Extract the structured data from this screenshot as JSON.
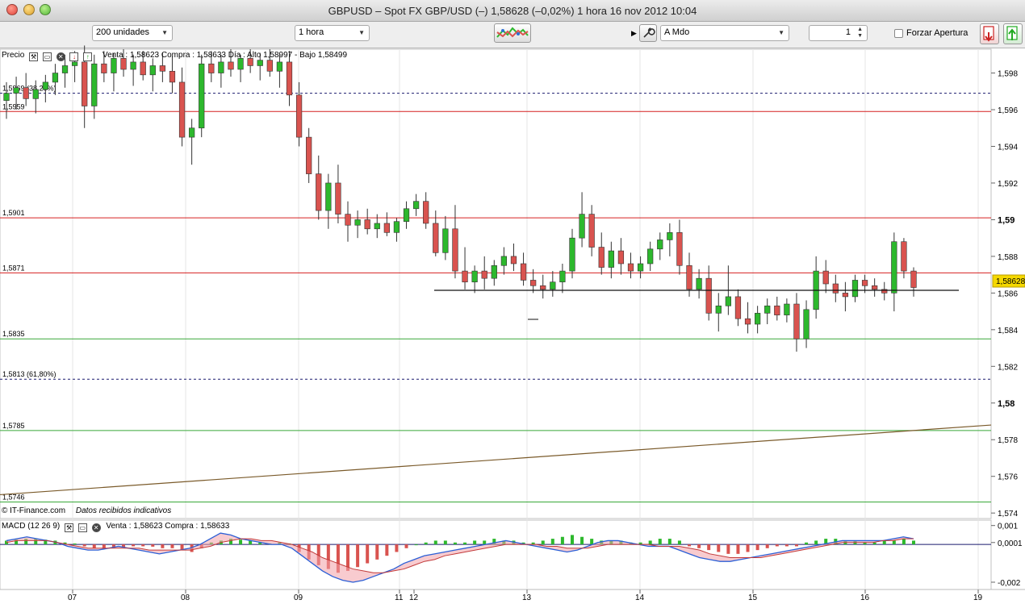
{
  "window": {
    "title": "GBPUSD – Spot FX GBP/USD (–)    1,58628 (–0,02%)    1 hora  16 nov 2012 10:04"
  },
  "toolbar": {
    "units": "200 unidades",
    "period": "1 hora",
    "order_type": "A Mdo",
    "quantity": "1",
    "force_open_label": "Forzar Apertura",
    "icons": [
      "indicators-icon",
      "settings-icon",
      "sell-icon",
      "buy-icon"
    ]
  },
  "price_panel": {
    "title": "Precio",
    "info": "Venta : 1,58623 Compra : 1,58633  Día : Alto 1,58997 - Bajo 1,58499",
    "credit": "© IT-Finance.com",
    "credit_note": "Datos recibidos indicativos",
    "current_price": "1,58628",
    "level_labels": [
      {
        "text": "1,5969 (38,20%)",
        "value": 1.5969
      },
      {
        "text": "1,5959",
        "value": 1.5959
      },
      {
        "text": "1,5901",
        "value": 1.5901
      },
      {
        "text": "1,5871",
        "value": 1.5871
      },
      {
        "text": "1,5835",
        "value": 1.5835
      },
      {
        "text": "1,5813 (61,80%)",
        "value": 1.5813
      },
      {
        "text": "1,5785",
        "value": 1.5785
      },
      {
        "text": "1,5746",
        "value": 1.5746
      }
    ]
  },
  "macd_panel": {
    "title": "MACD (12 26 9)",
    "info": "Venta : 1,58623 Compra : 1,58633",
    "y_labels": [
      "0,001",
      "0,0001",
      "-0,002"
    ]
  },
  "colors": {
    "up": "#2db82d",
    "down": "#d9534f",
    "resistance": "#d62020",
    "support": "#38a838",
    "fib": "#1a1a6e",
    "trend": "#7a5a2a",
    "price_tag": "#f5d800"
  },
  "chart_data": {
    "type": "candlestick",
    "title": "",
    "x_ticks": [
      "07",
      "08",
      "09",
      "11",
      "12",
      "13",
      "14",
      "15",
      "16",
      "19"
    ],
    "y_ticks": [
      "1,598",
      "1,596",
      "1,594",
      "1,592",
      "1,59",
      "1,588",
      "1,586",
      "1,584",
      "1,582",
      "1,58",
      "1,578",
      "1,576",
      "1,574"
    ],
    "ylim": [
      1.5737,
      1.5993
    ],
    "candles": [
      [
        1.5965,
        1.5975,
        1.5955,
        1.5969
      ],
      [
        1.5969,
        1.5978,
        1.596,
        1.5972
      ],
      [
        1.5972,
        1.598,
        1.5962,
        1.5966
      ],
      [
        1.5966,
        1.5976,
        1.5958,
        1.5971
      ],
      [
        1.5971,
        1.5979,
        1.5964,
        1.5975
      ],
      [
        1.5975,
        1.5985,
        1.5968,
        1.598
      ],
      [
        1.598,
        1.599,
        1.5972,
        1.5984
      ],
      [
        1.5984,
        1.5992,
        1.5975,
        1.5986
      ],
      [
        1.5986,
        1.5995,
        1.595,
        1.5962
      ],
      [
        1.5962,
        1.599,
        1.5955,
        1.5985
      ],
      [
        1.5985,
        1.5992,
        1.5975,
        1.598
      ],
      [
        1.598,
        1.5991,
        1.597,
        1.5988
      ],
      [
        1.5988,
        1.5993,
        1.5978,
        1.5982
      ],
      [
        1.5982,
        1.599,
        1.5973,
        1.5986
      ],
      [
        1.5986,
        1.5992,
        1.5976,
        1.5979
      ],
      [
        1.5979,
        1.5988,
        1.597,
        1.5984
      ],
      [
        1.5984,
        1.5991,
        1.5975,
        1.5981
      ],
      [
        1.5981,
        1.5989,
        1.5969,
        1.5975
      ],
      [
        1.5975,
        1.5983,
        1.594,
        1.5945
      ],
      [
        1.5945,
        1.5955,
        1.593,
        1.595
      ],
      [
        1.595,
        1.599,
        1.5945,
        1.5985
      ],
      [
        1.5985,
        1.5992,
        1.5975,
        1.598
      ],
      [
        1.598,
        1.599,
        1.5972,
        1.5986
      ],
      [
        1.5986,
        1.5993,
        1.5978,
        1.5982
      ],
      [
        1.5982,
        1.599,
        1.5975,
        1.5988
      ],
      [
        1.5988,
        1.5993,
        1.598,
        1.5984
      ],
      [
        1.5984,
        1.5991,
        1.5976,
        1.5987
      ],
      [
        1.5987,
        1.5993,
        1.5978,
        1.5981
      ],
      [
        1.5981,
        1.599,
        1.5972,
        1.5986
      ],
      [
        1.5986,
        1.5992,
        1.5962,
        1.5968
      ],
      [
        1.5968,
        1.5975,
        1.594,
        1.5945
      ],
      [
        1.5945,
        1.595,
        1.592,
        1.5925
      ],
      [
        1.5925,
        1.5935,
        1.59,
        1.5905
      ],
      [
        1.5905,
        1.5925,
        1.5895,
        1.592
      ],
      [
        1.592,
        1.593,
        1.5898,
        1.5903
      ],
      [
        1.5903,
        1.591,
        1.5888,
        1.5897
      ],
      [
        1.5897,
        1.5905,
        1.589,
        1.59
      ],
      [
        1.59,
        1.5906,
        1.5892,
        1.5895
      ],
      [
        1.5895,
        1.5903,
        1.589,
        1.5898
      ],
      [
        1.5898,
        1.5904,
        1.5891,
        1.5893
      ],
      [
        1.5893,
        1.5901,
        1.5888,
        1.5899
      ],
      [
        1.5899,
        1.591,
        1.5895,
        1.5906
      ],
      [
        1.5906,
        1.5914,
        1.5902,
        1.591
      ],
      [
        1.591,
        1.5915,
        1.5895,
        1.5898
      ],
      [
        1.5898,
        1.5905,
        1.588,
        1.5882
      ],
      [
        1.5882,
        1.5902,
        1.5878,
        1.5895
      ],
      [
        1.5895,
        1.5908,
        1.5868,
        1.5872
      ],
      [
        1.5872,
        1.5885,
        1.5862,
        1.5866
      ],
      [
        1.5866,
        1.5875,
        1.586,
        1.5872
      ],
      [
        1.5872,
        1.588,
        1.5862,
        1.5868
      ],
      [
        1.5868,
        1.5878,
        1.5864,
        1.5875
      ],
      [
        1.5875,
        1.5885,
        1.587,
        1.588
      ],
      [
        1.588,
        1.5887,
        1.5872,
        1.5876
      ],
      [
        1.5876,
        1.5882,
        1.5864,
        1.5867
      ],
      [
        1.5867,
        1.5873,
        1.586,
        1.5864
      ],
      [
        1.5864,
        1.587,
        1.5857,
        1.5862
      ],
      [
        1.5862,
        1.5872,
        1.5858,
        1.5866
      ],
      [
        1.5866,
        1.5876,
        1.586,
        1.5872
      ],
      [
        1.5872,
        1.5895,
        1.5868,
        1.589
      ],
      [
        1.589,
        1.5915,
        1.5885,
        1.5903
      ],
      [
        1.5903,
        1.5908,
        1.588,
        1.5885
      ],
      [
        1.5885,
        1.5893,
        1.587,
        1.5874
      ],
      [
        1.5874,
        1.5888,
        1.5868,
        1.5883
      ],
      [
        1.5883,
        1.589,
        1.587,
        1.5876
      ],
      [
        1.5876,
        1.5882,
        1.5868,
        1.5872
      ],
      [
        1.5872,
        1.588,
        1.5868,
        1.5876
      ],
      [
        1.5876,
        1.5888,
        1.5872,
        1.5884
      ],
      [
        1.5884,
        1.5893,
        1.5878,
        1.5889
      ],
      [
        1.5889,
        1.5898,
        1.588,
        1.5893
      ],
      [
        1.5893,
        1.59,
        1.587,
        1.5875
      ],
      [
        1.5875,
        1.5882,
        1.5858,
        1.5862
      ],
      [
        1.5862,
        1.5873,
        1.5857,
        1.5868
      ],
      [
        1.5868,
        1.5875,
        1.5845,
        1.5849
      ],
      [
        1.5849,
        1.586,
        1.5839,
        1.5853
      ],
      [
        1.5853,
        1.5875,
        1.5848,
        1.5858
      ],
      [
        1.5858,
        1.5862,
        1.5842,
        1.5846
      ],
      [
        1.5846,
        1.5855,
        1.5838,
        1.5843
      ],
      [
        1.5843,
        1.5853,
        1.5838,
        1.5849
      ],
      [
        1.5849,
        1.5857,
        1.5843,
        1.5853
      ],
      [
        1.5853,
        1.5858,
        1.5845,
        1.5848
      ],
      [
        1.5848,
        1.5857,
        1.5844,
        1.5854
      ],
      [
        1.5854,
        1.586,
        1.5828,
        1.5835
      ],
      [
        1.5835,
        1.5856,
        1.583,
        1.5851
      ],
      [
        1.5851,
        1.588,
        1.5846,
        1.5872
      ],
      [
        1.5872,
        1.5878,
        1.586,
        1.5865
      ],
      [
        1.5865,
        1.587,
        1.5855,
        1.586
      ],
      [
        1.586,
        1.5866,
        1.585,
        1.5858
      ],
      [
        1.5858,
        1.587,
        1.5855,
        1.5867
      ],
      [
        1.5867,
        1.587,
        1.586,
        1.5864
      ],
      [
        1.5864,
        1.5868,
        1.5858,
        1.5862
      ],
      [
        1.5862,
        1.5866,
        1.5856,
        1.586
      ],
      [
        1.586,
        1.5893,
        1.585,
        1.5888
      ],
      [
        1.5888,
        1.589,
        1.5868,
        1.5872
      ],
      [
        1.5872,
        1.5874,
        1.5858,
        1.5863
      ]
    ],
    "horizontal_levels": [
      {
        "value": 1.5969,
        "style": "fib-dashed"
      },
      {
        "value": 1.5959,
        "style": "resistance"
      },
      {
        "value": 1.5901,
        "style": "resistance"
      },
      {
        "value": 1.5871,
        "style": "resistance"
      },
      {
        "value": 1.5835,
        "style": "support"
      },
      {
        "value": 1.5813,
        "style": "fib-dashed"
      },
      {
        "value": 1.5785,
        "style": "support"
      },
      {
        "value": 1.5746,
        "style": "support"
      }
    ],
    "trendline": {
      "from_value": 1.575,
      "to_value": 1.5788
    },
    "macd": {
      "ylim": [
        -0.0023,
        0.0012
      ],
      "histogram": [
        0.0002,
        0.00025,
        0.0003,
        0.0003,
        0.00025,
        0.0002,
        0.0001,
        5e-05,
        -0.0001,
        -0.0002,
        -0.00025,
        -0.0002,
        -0.00015,
        -0.0001,
        -0.0001,
        -0.00012,
        -0.0002,
        -0.0002,
        -0.0003,
        -0.0004,
        -0.0002,
        0.0001,
        0.0002,
        0.0003,
        0.00025,
        0.0002,
        0.0001,
        5e-05,
        0.0001,
        5e-05,
        -0.0004,
        -0.0008,
        -0.0011,
        -0.0013,
        -0.0015,
        -0.0014,
        -0.0012,
        -0.001,
        -0.0008,
        -0.0006,
        -0.0004,
        -0.0002,
        0.0,
        0.0001,
        0.0002,
        0.0002,
        0.0001,
        0.0001,
        0.0002,
        0.0002,
        0.0003,
        0.0002,
        0.0002,
        0.0001,
        0.0001,
        0.0002,
        0.0003,
        0.0004,
        0.0005,
        0.0004,
        0.0003,
        0.0002,
        0.0002,
        0.0002,
        0.0001,
        0.0001,
        0.0002,
        0.0003,
        0.0003,
        0.0002,
        -0.0001,
        -0.0002,
        -0.0003,
        -0.0004,
        -0.0005,
        -0.0005,
        -0.0004,
        -0.0003,
        -0.0002,
        -0.0001,
        -0.0001,
        -0.0001,
        0.0001,
        0.0002,
        0.0003,
        0.0003,
        0.0002,
        0.0002,
        0.0001,
        0.0001,
        0.0002,
        0.0002,
        0.0003,
        0.0002
      ],
      "macd_line": [
        0.0002,
        0.0003,
        0.0004,
        0.0003,
        0.0002,
        0.0001,
        -0.0001,
        -0.0002,
        -0.0003,
        -0.0003,
        -0.0002,
        -0.0001,
        -0.0002,
        -0.0003,
        -0.0004,
        -0.0005,
        -0.0004,
        -0.0003,
        -0.0002,
        0.0,
        0.0003,
        0.0006,
        0.0005,
        0.0003,
        0.0002,
        0.0001,
        0.0,
        0.0,
        -0.0002,
        -0.0006,
        -0.001,
        -0.0014,
        -0.0017,
        -0.0019,
        -0.002,
        -0.0019,
        -0.0017,
        -0.0015,
        -0.0013,
        -0.001,
        -0.0008,
        -0.0006,
        -0.0005,
        -0.0004,
        -0.0003,
        -0.0002,
        -0.0001,
        0.0,
        0.0001,
        0.0002,
        0.0001,
        0.0,
        -0.0001,
        -0.0002,
        -0.0003,
        -0.0004,
        -0.0003,
        -0.0001,
        0.0001,
        0.0002,
        0.0002,
        0.0001,
        0.0,
        -0.0001,
        -0.0001,
        -0.0001,
        -0.0003,
        -0.0005,
        -0.0007,
        -0.0008,
        -0.0009,
        -0.0009,
        -0.0008,
        -0.0007,
        -0.0006,
        -0.0005,
        -0.0004,
        -0.0003,
        -0.0002,
        -0.0001,
        0.0,
        0.0001,
        0.0002,
        0.0002,
        0.0002,
        0.0002,
        0.0002,
        0.0003,
        0.0004,
        0.0003
      ],
      "signal_line": [
        0.0001,
        0.0002,
        0.0002,
        0.0002,
        0.0002,
        0.0001,
        0.0,
        -0.0001,
        -0.0002,
        -0.0002,
        -0.0002,
        -0.0002,
        -0.0002,
        -0.0002,
        -0.0003,
        -0.0003,
        -0.0003,
        -0.0003,
        -0.0003,
        -0.0002,
        -0.0001,
        0.0001,
        0.0002,
        0.0003,
        0.0003,
        0.0002,
        0.0002,
        0.0001,
        0.0,
        -0.0002,
        -0.0004,
        -0.0007,
        -0.0009,
        -0.0011,
        -0.0013,
        -0.0014,
        -0.0015,
        -0.0015,
        -0.0014,
        -0.0013,
        -0.0011,
        -0.0009,
        -0.0008,
        -0.0006,
        -0.0005,
        -0.0004,
        -0.0003,
        -0.0002,
        -0.0001,
        0.0,
        0.0,
        0.0,
        0.0,
        -0.0001,
        -0.0001,
        -0.0002,
        -0.0002,
        -0.0002,
        -0.0001,
        0.0,
        0.0,
        0.0,
        0.0,
        0.0,
        -0.0001,
        -0.0001,
        -0.0001,
        -0.0002,
        -0.0003,
        -0.0005,
        -0.0006,
        -0.0007,
        -0.0007,
        -0.0007,
        -0.0007,
        -0.0006,
        -0.0005,
        -0.0004,
        -0.0003,
        -0.0002,
        -0.0001,
        0.0,
        0.0001,
        0.0001,
        0.0001,
        0.0001,
        0.0002,
        0.0002,
        0.0003,
        0.0003
      ]
    }
  }
}
